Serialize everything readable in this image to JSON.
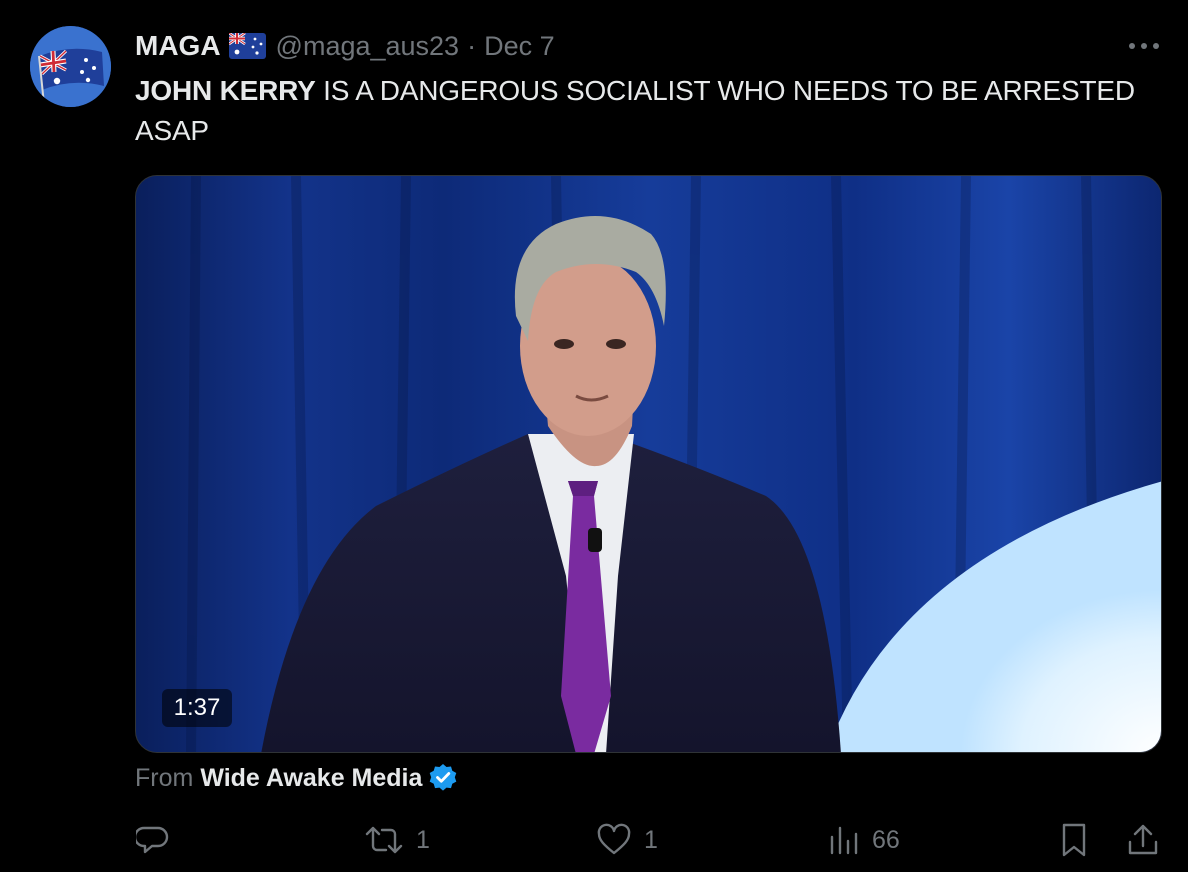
{
  "author": {
    "display_name": "MAGA",
    "flag_icon": "australia-flag-icon",
    "handle": "@maga_aus23",
    "separator": "·",
    "date": "Dec 7",
    "avatar_icon": "australia-flag-avatar"
  },
  "tweet": {
    "text_bold": "JOHN KERRY",
    "text_rest": " IS A DANGEROUS SOCIALIST WHO NEEDS TO BE ARRESTED ASAP"
  },
  "media": {
    "duration": "1:37",
    "from_label": "From",
    "source_name": "Wide Awake Media",
    "source_verified": true
  },
  "actions": {
    "reply": {
      "icon": "reply-icon",
      "count": ""
    },
    "retweet": {
      "icon": "retweet-icon",
      "count": "1"
    },
    "like": {
      "icon": "heart-icon",
      "count": "1"
    },
    "views": {
      "icon": "views-icon",
      "count": "66"
    },
    "bookmark": {
      "icon": "bookmark-icon"
    },
    "share": {
      "icon": "share-icon"
    }
  },
  "colors": {
    "background": "#000000",
    "text_primary": "#e7e9ea",
    "text_secondary": "#71767b",
    "verified_blue": "#1d9bf0"
  }
}
